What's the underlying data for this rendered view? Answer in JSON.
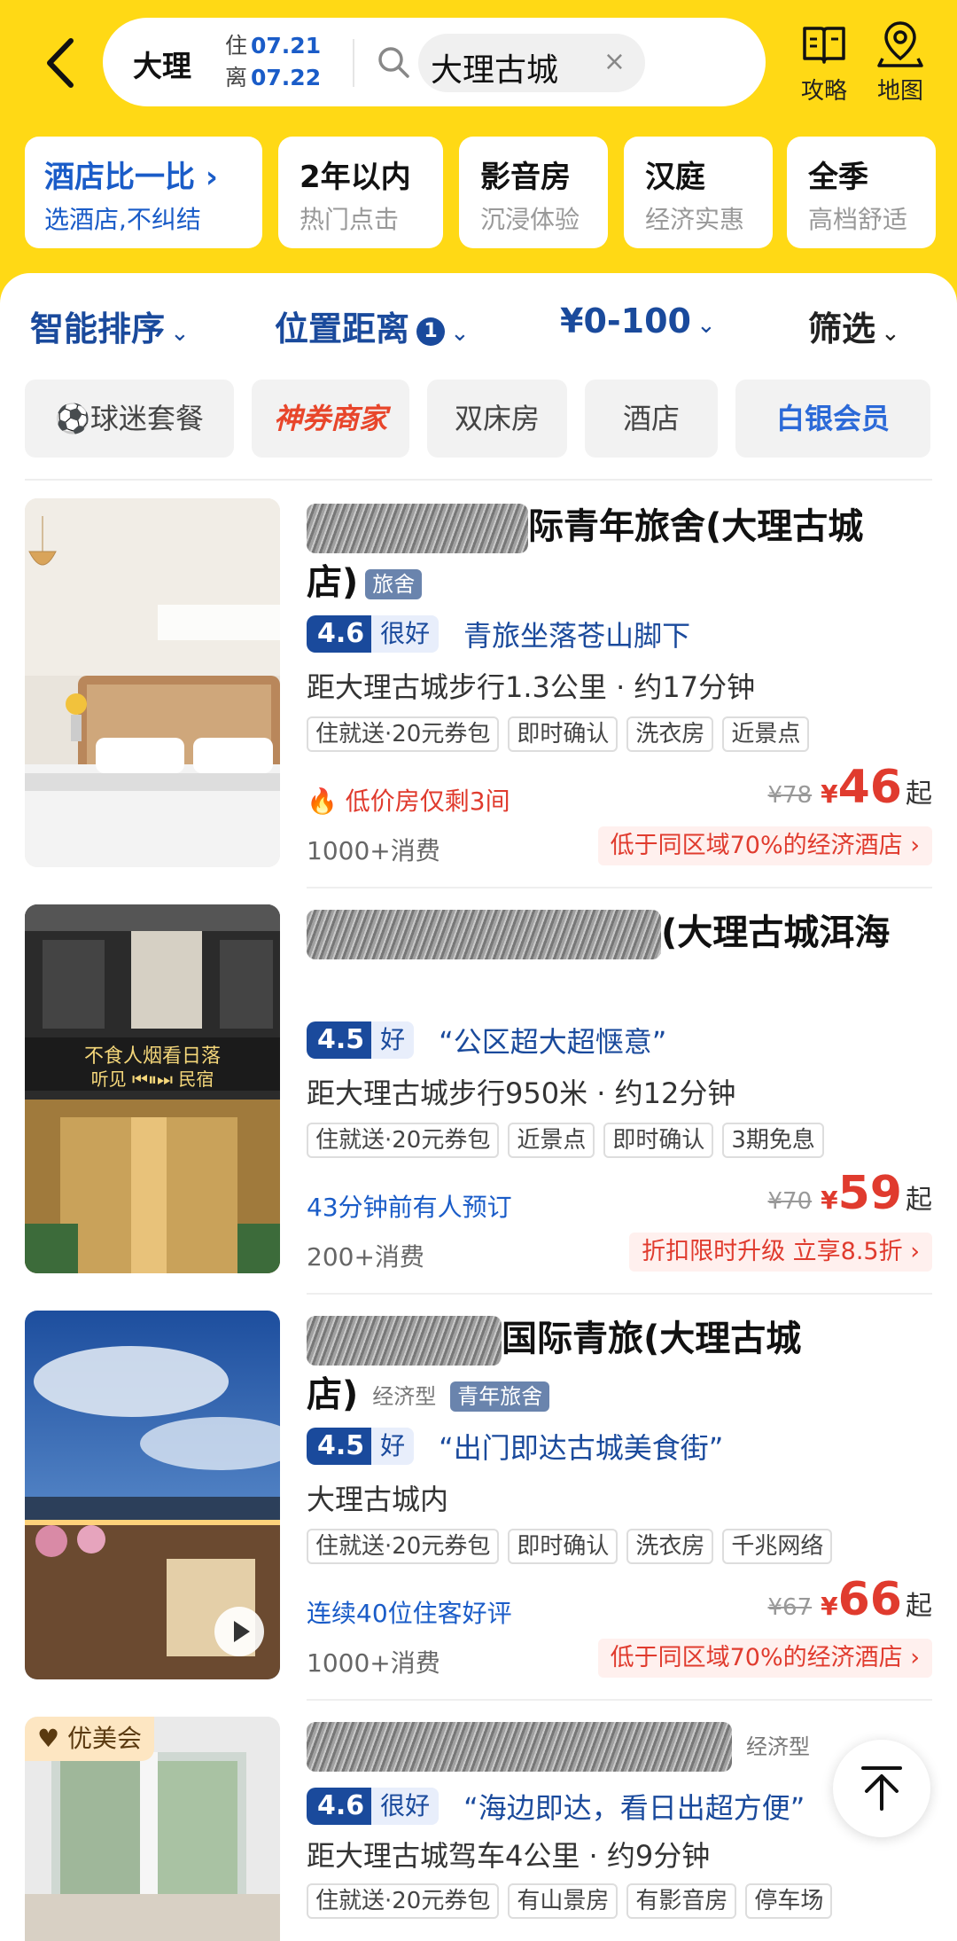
{
  "header": {
    "city": "大理",
    "checkin_label": "住",
    "checkin_date": "07.21",
    "checkout_label": "离",
    "checkout_date": "07.22",
    "keyword": "大理古城",
    "clear": "×",
    "guide_label": "攻略",
    "map_label": "地图"
  },
  "quick_cards": [
    {
      "title": "酒店比一比 ›",
      "sub": "选酒店,不纠结"
    },
    {
      "title": "2年以内",
      "sub": "热门点击"
    },
    {
      "title": "影音房",
      "sub": "沉浸体验"
    },
    {
      "title": "汉庭",
      "sub": "经济实惠"
    },
    {
      "title": "全季",
      "sub": "高档舒适"
    }
  ],
  "sort_bar": {
    "smart": "智能排序",
    "distance": "位置距离",
    "distance_count": "1",
    "price": "¥0-100",
    "filter": "筛选",
    "chevron": "⌄"
  },
  "chips": [
    "⚽球迷套餐",
    "神券商家",
    "双床房",
    "酒店",
    "白银会员"
  ],
  "hotels": [
    {
      "name_visible": "际青年旅舍(大理古城",
      "name_line2": "店)",
      "tag": "旅舍",
      "score": "4.6",
      "score_word": "很好",
      "quote": "青旅坐落苍山脚下",
      "distance": "距大理古城步行1.3公里 · 约17分钟",
      "features": [
        "住就送·20元券包",
        "即时确认",
        "洗衣房",
        "近景点"
      ],
      "promo": "低价房仅剩3间",
      "old_price": "¥78",
      "yen": "¥",
      "price": "46",
      "qi": "起",
      "sales": "1000+消费",
      "deal": "低于同区域70%的经济酒店 ›"
    },
    {
      "name_visible": "(大理古城洱海",
      "name_line2": "",
      "tag": "",
      "score": "4.5",
      "score_word": "好",
      "quote": "“公区超大超惬意”",
      "distance": "距大理古城步行950米 · 约12分钟",
      "features": [
        "住就送·20元券包",
        "近景点",
        "即时确认",
        "3期免息"
      ],
      "promo": "43分钟前有人预订",
      "old_price": "¥70",
      "yen": "¥",
      "price": "59",
      "qi": "起",
      "sales": "200+消费",
      "deal": "折扣限时升级 立享8.5折 ›",
      "sign_line1": "不食人烟看日落",
      "sign_line2": "听见 ⏮⏸⏭ 民宿"
    },
    {
      "name_visible": "国际青旅(大理古城",
      "name_line2": "店)",
      "tag_type": "经济型",
      "tag": "青年旅舍",
      "score": "4.5",
      "score_word": "好",
      "quote": "“出门即达古城美食街”",
      "distance": "大理古城内",
      "features": [
        "住就送·20元券包",
        "即时确认",
        "洗衣房",
        "千兆网络"
      ],
      "promo": "连续40位住客好评",
      "old_price": "¥67",
      "yen": "¥",
      "price": "66",
      "qi": "起",
      "sales": "1000+消费",
      "deal": "低于同区域70%的经济酒店 ›"
    },
    {
      "badge": "优美会",
      "tag_type": "经济型",
      "score": "4.6",
      "score_word": "很好",
      "quote": "“海边即达，看日出超方便”",
      "distance": "距大理古城驾车4公里 · 约9分钟",
      "features": [
        "住就送·20元券包",
        "有山景房",
        "有影音房",
        "停车场"
      ]
    }
  ]
}
